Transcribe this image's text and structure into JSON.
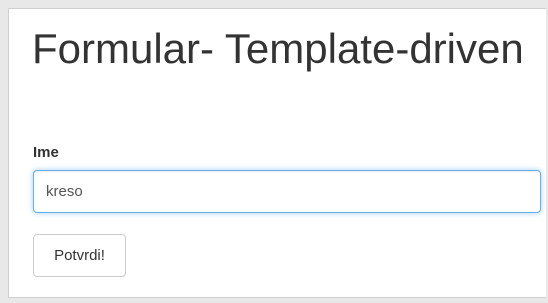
{
  "page": {
    "title": "Formular- Template-driven"
  },
  "form": {
    "name_label": "Ime",
    "name_value": "kreso",
    "submit_label": "Potvrdi!"
  },
  "colors": {
    "focus_border": "#66afe9",
    "text": "#333333"
  }
}
